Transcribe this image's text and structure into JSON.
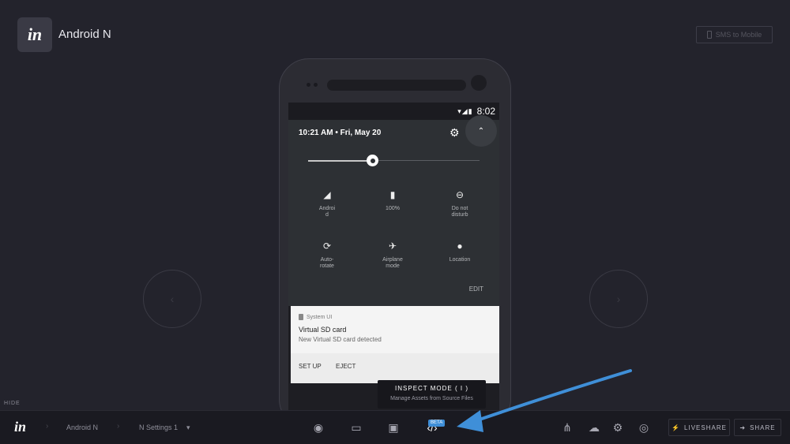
{
  "header": {
    "app_title": "Android N",
    "sms_button": "SMS to Mobile",
    "logo_text": "in"
  },
  "phone": {
    "status_time": "8:02",
    "status_icons": "▾◢▮",
    "qs": {
      "datetime": "10:21 AM • Fri, May 20",
      "brightness_percent": 38,
      "tiles": [
        {
          "icon": "signal-icon",
          "label": "Androi\nd"
        },
        {
          "icon": "battery-icon",
          "label": "100%"
        },
        {
          "icon": "do-not-disturb-icon",
          "label": "Do not\ndisturb"
        },
        {
          "icon": "auto-rotate-icon",
          "label": "Auto-\nrotate"
        },
        {
          "icon": "airplane-icon",
          "label": "Airplane\nmode"
        },
        {
          "icon": "location-icon",
          "label": "Location"
        }
      ],
      "edit": "EDIT"
    },
    "notification": {
      "app": "System UI",
      "title": "Virtual SD card",
      "body": "New Virtual SD card detected",
      "actions": [
        "SET UP",
        "EJECT"
      ]
    }
  },
  "tooltip": {
    "title": "INSPECT MODE ( I )",
    "subtitle": "Manage Assets from Source Files"
  },
  "hide_label": "HIDE",
  "toolbar": {
    "logo_text": "in",
    "breadcrumb_project": "Android N",
    "breadcrumb_screen": "N Settings 1",
    "inspect_badge": "BETA",
    "liveshare": "LIVESHARE",
    "share": "SHARE"
  },
  "colors": {
    "background": "#23232c",
    "toolbar": "#1a1a21",
    "accent_arrow": "#3f8fd8"
  }
}
